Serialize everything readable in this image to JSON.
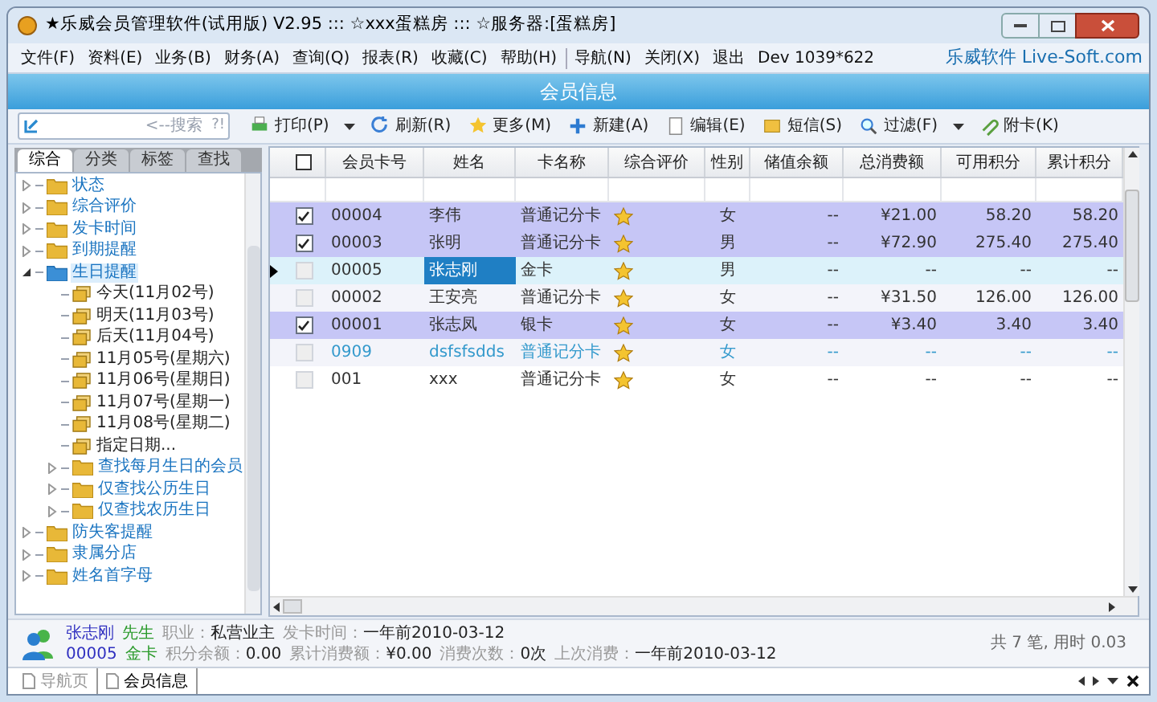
{
  "window": {
    "title": "★乐威会员管理软件(试用版) V2.95 ::: ☆xxx蛋糕房 ::: ☆服务器:[蛋糕房]"
  },
  "menu": [
    "文件(F)",
    "资料(E)",
    "业务(B)",
    "财务(A)",
    "查询(Q)",
    "报表(R)",
    "收藏(C)",
    "帮助(H)",
    "导航(N)",
    "关闭(X)",
    "退出",
    "Dev 1039*622"
  ],
  "brand": "乐威软件 Live-Soft.com",
  "header": "会员信息",
  "search": {
    "placeholder": "<--搜索",
    "hint": "?!"
  },
  "toolbar": [
    {
      "label": "打印(P)",
      "dropdown": true
    },
    {
      "label": "刷新(R)",
      "dropdown": false
    },
    {
      "label": "更多(M)",
      "dropdown": false
    },
    {
      "label": "新建(A)",
      "dropdown": false
    },
    {
      "label": "编辑(E)",
      "dropdown": false
    },
    {
      "label": "短信(S)",
      "dropdown": false
    },
    {
      "label": "过滤(F)",
      "dropdown": true
    },
    {
      "label": "附卡(K)",
      "dropdown": false
    }
  ],
  "side_tabs": [
    {
      "label": "综合",
      "selected": true
    },
    {
      "label": "分类",
      "selected": false
    },
    {
      "label": "标签",
      "selected": false
    },
    {
      "label": "查找",
      "selected": false
    }
  ],
  "tree": [
    {
      "label": "状态",
      "expanded": false,
      "selected": false
    },
    {
      "label": "综合评价",
      "expanded": false,
      "selected": false
    },
    {
      "label": "发卡时间",
      "expanded": false,
      "selected": false
    },
    {
      "label": "到期提醒",
      "expanded": false,
      "selected": false
    },
    {
      "label": "生日提醒",
      "expanded": true,
      "selected": true,
      "children": [
        {
          "label": "今天(11月02号)",
          "kind": "leaf",
          "selected": false
        },
        {
          "label": "明天(11月03号)",
          "kind": "leaf",
          "selected": false
        },
        {
          "label": "后天(11月04号)",
          "kind": "leaf",
          "selected": false
        },
        {
          "label": "11月05号(星期六)",
          "kind": "leaf",
          "selected": false
        },
        {
          "label": "11月06号(星期日)",
          "kind": "leaf",
          "selected": false
        },
        {
          "label": "11月07号(星期一)",
          "kind": "leaf",
          "selected": false
        },
        {
          "label": "11月08号(星期二)",
          "kind": "leaf",
          "selected": false
        },
        {
          "label": "指定日期...",
          "kind": "leaf",
          "selected": false
        },
        {
          "label": "查找每月生日的会员",
          "kind": "folder",
          "expanded": false,
          "selected": false
        },
        {
          "label": "仅查找公历生日",
          "kind": "folder",
          "expanded": false,
          "selected": false
        },
        {
          "label": "仅查找农历生日",
          "kind": "folder",
          "expanded": false,
          "selected": false
        }
      ]
    },
    {
      "label": "防失客提醒",
      "expanded": false,
      "selected": false
    },
    {
      "label": "隶属分店",
      "expanded": false,
      "selected": false
    },
    {
      "label": "姓名首字母",
      "expanded": false,
      "selected": false
    }
  ],
  "table": {
    "select_all_checked": false,
    "columns": [
      "会员卡号",
      "姓名",
      "卡名称",
      "综合评价",
      "性别",
      "储值余额",
      "总消费额",
      "可用积分",
      "累计积分"
    ],
    "rows": [
      {
        "checked": true,
        "selected": false,
        "color": "#333333",
        "cells": [
          "00004",
          "李伟",
          "普通记分卡",
          "",
          "女",
          "--",
          "¥21.00",
          "58.20",
          "58.20"
        ]
      },
      {
        "checked": true,
        "selected": false,
        "color": "#333333",
        "cells": [
          "00003",
          "张明",
          "普通记分卡",
          "",
          "男",
          "--",
          "¥72.90",
          "275.40",
          "275.40"
        ]
      },
      {
        "checked": false,
        "selected": true,
        "color": "#333333",
        "cells": [
          "00005",
          "张志刚",
          "金卡",
          "",
          "男",
          "--",
          "--",
          "--",
          "--"
        ]
      },
      {
        "checked": false,
        "selected": false,
        "color": "#333333",
        "cells": [
          "00002",
          "王安亮",
          "普通记分卡",
          "",
          "女",
          "--",
          "¥31.50",
          "126.00",
          "126.00"
        ]
      },
      {
        "checked": true,
        "selected": false,
        "color": "#333333",
        "cells": [
          "00001",
          "张志凤",
          "银卡",
          "",
          "女",
          "--",
          "¥3.40",
          "3.40",
          "3.40"
        ]
      },
      {
        "checked": false,
        "selected": false,
        "color": "#3399cc",
        "cells": [
          "0909",
          "dsfsfsdds",
          "普通记分卡",
          "",
          "女",
          "--",
          "--",
          "--",
          "--"
        ]
      },
      {
        "checked": false,
        "selected": false,
        "color": "#333333",
        "cells": [
          "001",
          "xxx",
          "普通记分卡",
          "",
          "女",
          "--",
          "--",
          "--",
          "--"
        ]
      }
    ]
  },
  "member": {
    "name": "张志刚",
    "title": "先生",
    "fields1": [
      {
        "label": "职业：",
        "value": "私营业主"
      },
      {
        "label": "发卡时间：",
        "value": "一年前2010-03-12"
      }
    ],
    "card_no": "00005",
    "card_name": "金卡",
    "fields2": [
      {
        "label": "积分余额：",
        "value": "0.00"
      },
      {
        "label": "累计消费额：",
        "value": "¥0.00"
      },
      {
        "label": "消费次数：",
        "value": "0次"
      },
      {
        "label": "上次消费：",
        "value": "一年前2010-03-12"
      }
    ]
  },
  "summary": "共 7 笔, 用时 0.03",
  "doc_tabs": [
    {
      "label": "导航页",
      "selected": false
    },
    {
      "label": "会员信息",
      "selected": true
    }
  ]
}
